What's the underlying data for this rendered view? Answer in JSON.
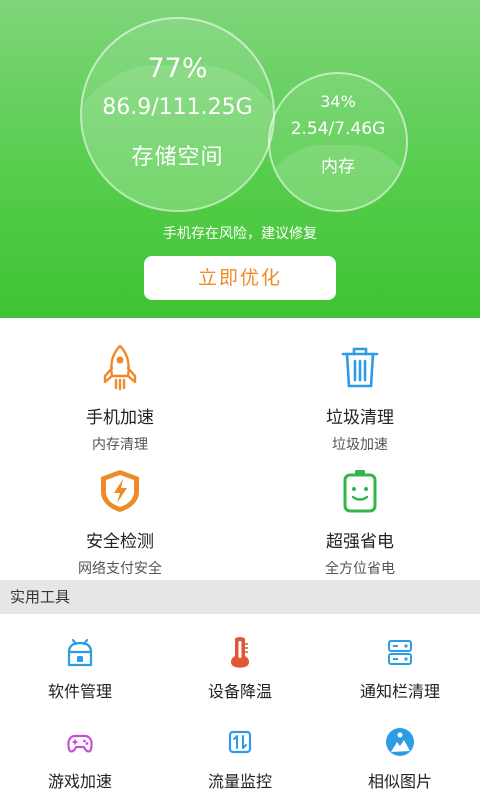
{
  "storage": {
    "percent": "77%",
    "usage": "86.9/111.25G",
    "label": "存储空间"
  },
  "memory": {
    "percent": "34%",
    "usage": "2.54/7.46G",
    "label": "内存"
  },
  "warning": "手机存在风险，建议修复",
  "optimize_button": "立即优化",
  "features": [
    {
      "title": "手机加速",
      "subtitle": "内存清理",
      "icon": "rocket-icon",
      "color": "#f08a28"
    },
    {
      "title": "垃圾清理",
      "subtitle": "垃圾加速",
      "icon": "trash-icon",
      "color": "#2d9be5"
    },
    {
      "title": "安全检测",
      "subtitle": "网络支付安全",
      "icon": "shield-icon",
      "color": "#f08a28"
    },
    {
      "title": "超强省电",
      "subtitle": "全方位省电",
      "icon": "battery-icon",
      "color": "#34b44a"
    }
  ],
  "tools_section_title": "实用工具",
  "tools": [
    {
      "label": "软件管理",
      "icon": "android-icon",
      "color": "#2d9be5"
    },
    {
      "label": "设备降温",
      "icon": "thermometer-icon",
      "color": "#e2553b"
    },
    {
      "label": "通知栏清理",
      "icon": "notification-icon",
      "color": "#2d9be5"
    },
    {
      "label": "游戏加速",
      "icon": "gamepad-icon",
      "color": "#c84fd6"
    },
    {
      "label": "流量监控",
      "icon": "traffic-icon",
      "color": "#2d9be5"
    },
    {
      "label": "相似图片",
      "icon": "image-icon",
      "color": "#2d9be5"
    }
  ]
}
